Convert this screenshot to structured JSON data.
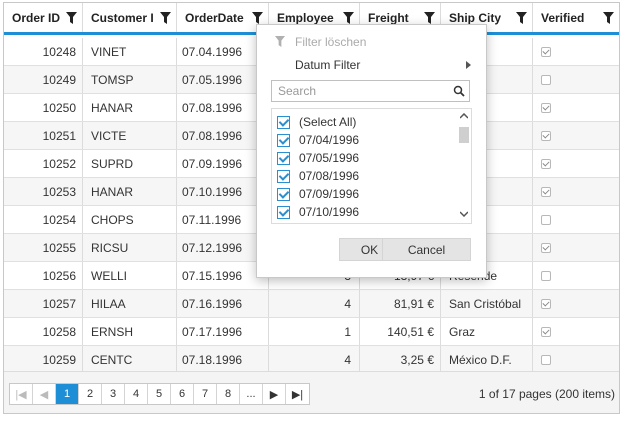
{
  "columns": [
    {
      "label": "Order ID"
    },
    {
      "label": "Customer I"
    },
    {
      "label": "OrderDate"
    },
    {
      "label": "Employee"
    },
    {
      "label": "Freight"
    },
    {
      "label": "Ship City"
    },
    {
      "label": "Verified"
    }
  ],
  "rows": [
    {
      "order_id": "10248",
      "customer": "VINET",
      "date": "07.04.1996",
      "employee": "",
      "freight": "",
      "city": "",
      "verified": true
    },
    {
      "order_id": "10249",
      "customer": "TOMSP",
      "date": "07.05.1996",
      "employee": "",
      "freight": "",
      "city": "",
      "verified": false
    },
    {
      "order_id": "10250",
      "customer": "HANAR",
      "date": "07.08.1996",
      "employee": "",
      "freight": "",
      "city": "aneiro",
      "verified": true
    },
    {
      "order_id": "10251",
      "customer": "VICTE",
      "date": "07.08.1996",
      "employee": "",
      "freight": "",
      "city": "",
      "verified": true
    },
    {
      "order_id": "10252",
      "customer": "SUPRD",
      "date": "07.09.1996",
      "employee": "",
      "freight": "",
      "city": "i",
      "verified": true
    },
    {
      "order_id": "10253",
      "customer": "HANAR",
      "date": "07.10.1996",
      "employee": "",
      "freight": "",
      "city": "aneiro",
      "verified": true
    },
    {
      "order_id": "10254",
      "customer": "CHOPS",
      "date": "07.11.1996",
      "employee": "",
      "freight": "",
      "city": "",
      "verified": false
    },
    {
      "order_id": "10255",
      "customer": "RICSU",
      "date": "07.12.1996",
      "employee": "",
      "freight": "",
      "city": "",
      "verified": true
    },
    {
      "order_id": "10256",
      "customer": "WELLI",
      "date": "07.15.1996",
      "employee": "3",
      "freight": "13,97 €",
      "city": "Resende",
      "verified": false
    },
    {
      "order_id": "10257",
      "customer": "HILAA",
      "date": "07.16.1996",
      "employee": "4",
      "freight": "81,91 €",
      "city": "San Cristóbal",
      "verified": true
    },
    {
      "order_id": "10258",
      "customer": "ERNSH",
      "date": "07.17.1996",
      "employee": "1",
      "freight": "140,51 €",
      "city": "Graz",
      "verified": true
    },
    {
      "order_id": "10259",
      "customer": "CENTC",
      "date": "07.18.1996",
      "employee": "4",
      "freight": "3,25 €",
      "city": "México D.F.",
      "verified": false
    }
  ],
  "filter_popup": {
    "clear_filter": "Filter löschen",
    "date_filter": "Datum Filter",
    "search_placeholder": "Search",
    "items": [
      "(Select All)",
      "07/04/1996",
      "07/05/1996",
      "07/08/1996",
      "07/09/1996",
      "07/10/1996"
    ],
    "ok": "OK",
    "cancel": "Cancel"
  },
  "pager": {
    "first": "|◀",
    "prev": "◀",
    "pages": [
      "1",
      "2",
      "3",
      "4",
      "5",
      "6",
      "7",
      "8",
      "..."
    ],
    "active_page": "1",
    "next": "▶",
    "last": "▶|",
    "info": "1 of 17 pages (200 items)"
  },
  "colors": {
    "accent": "#1e8fd6",
    "alt_row": "#f6f6f6"
  }
}
